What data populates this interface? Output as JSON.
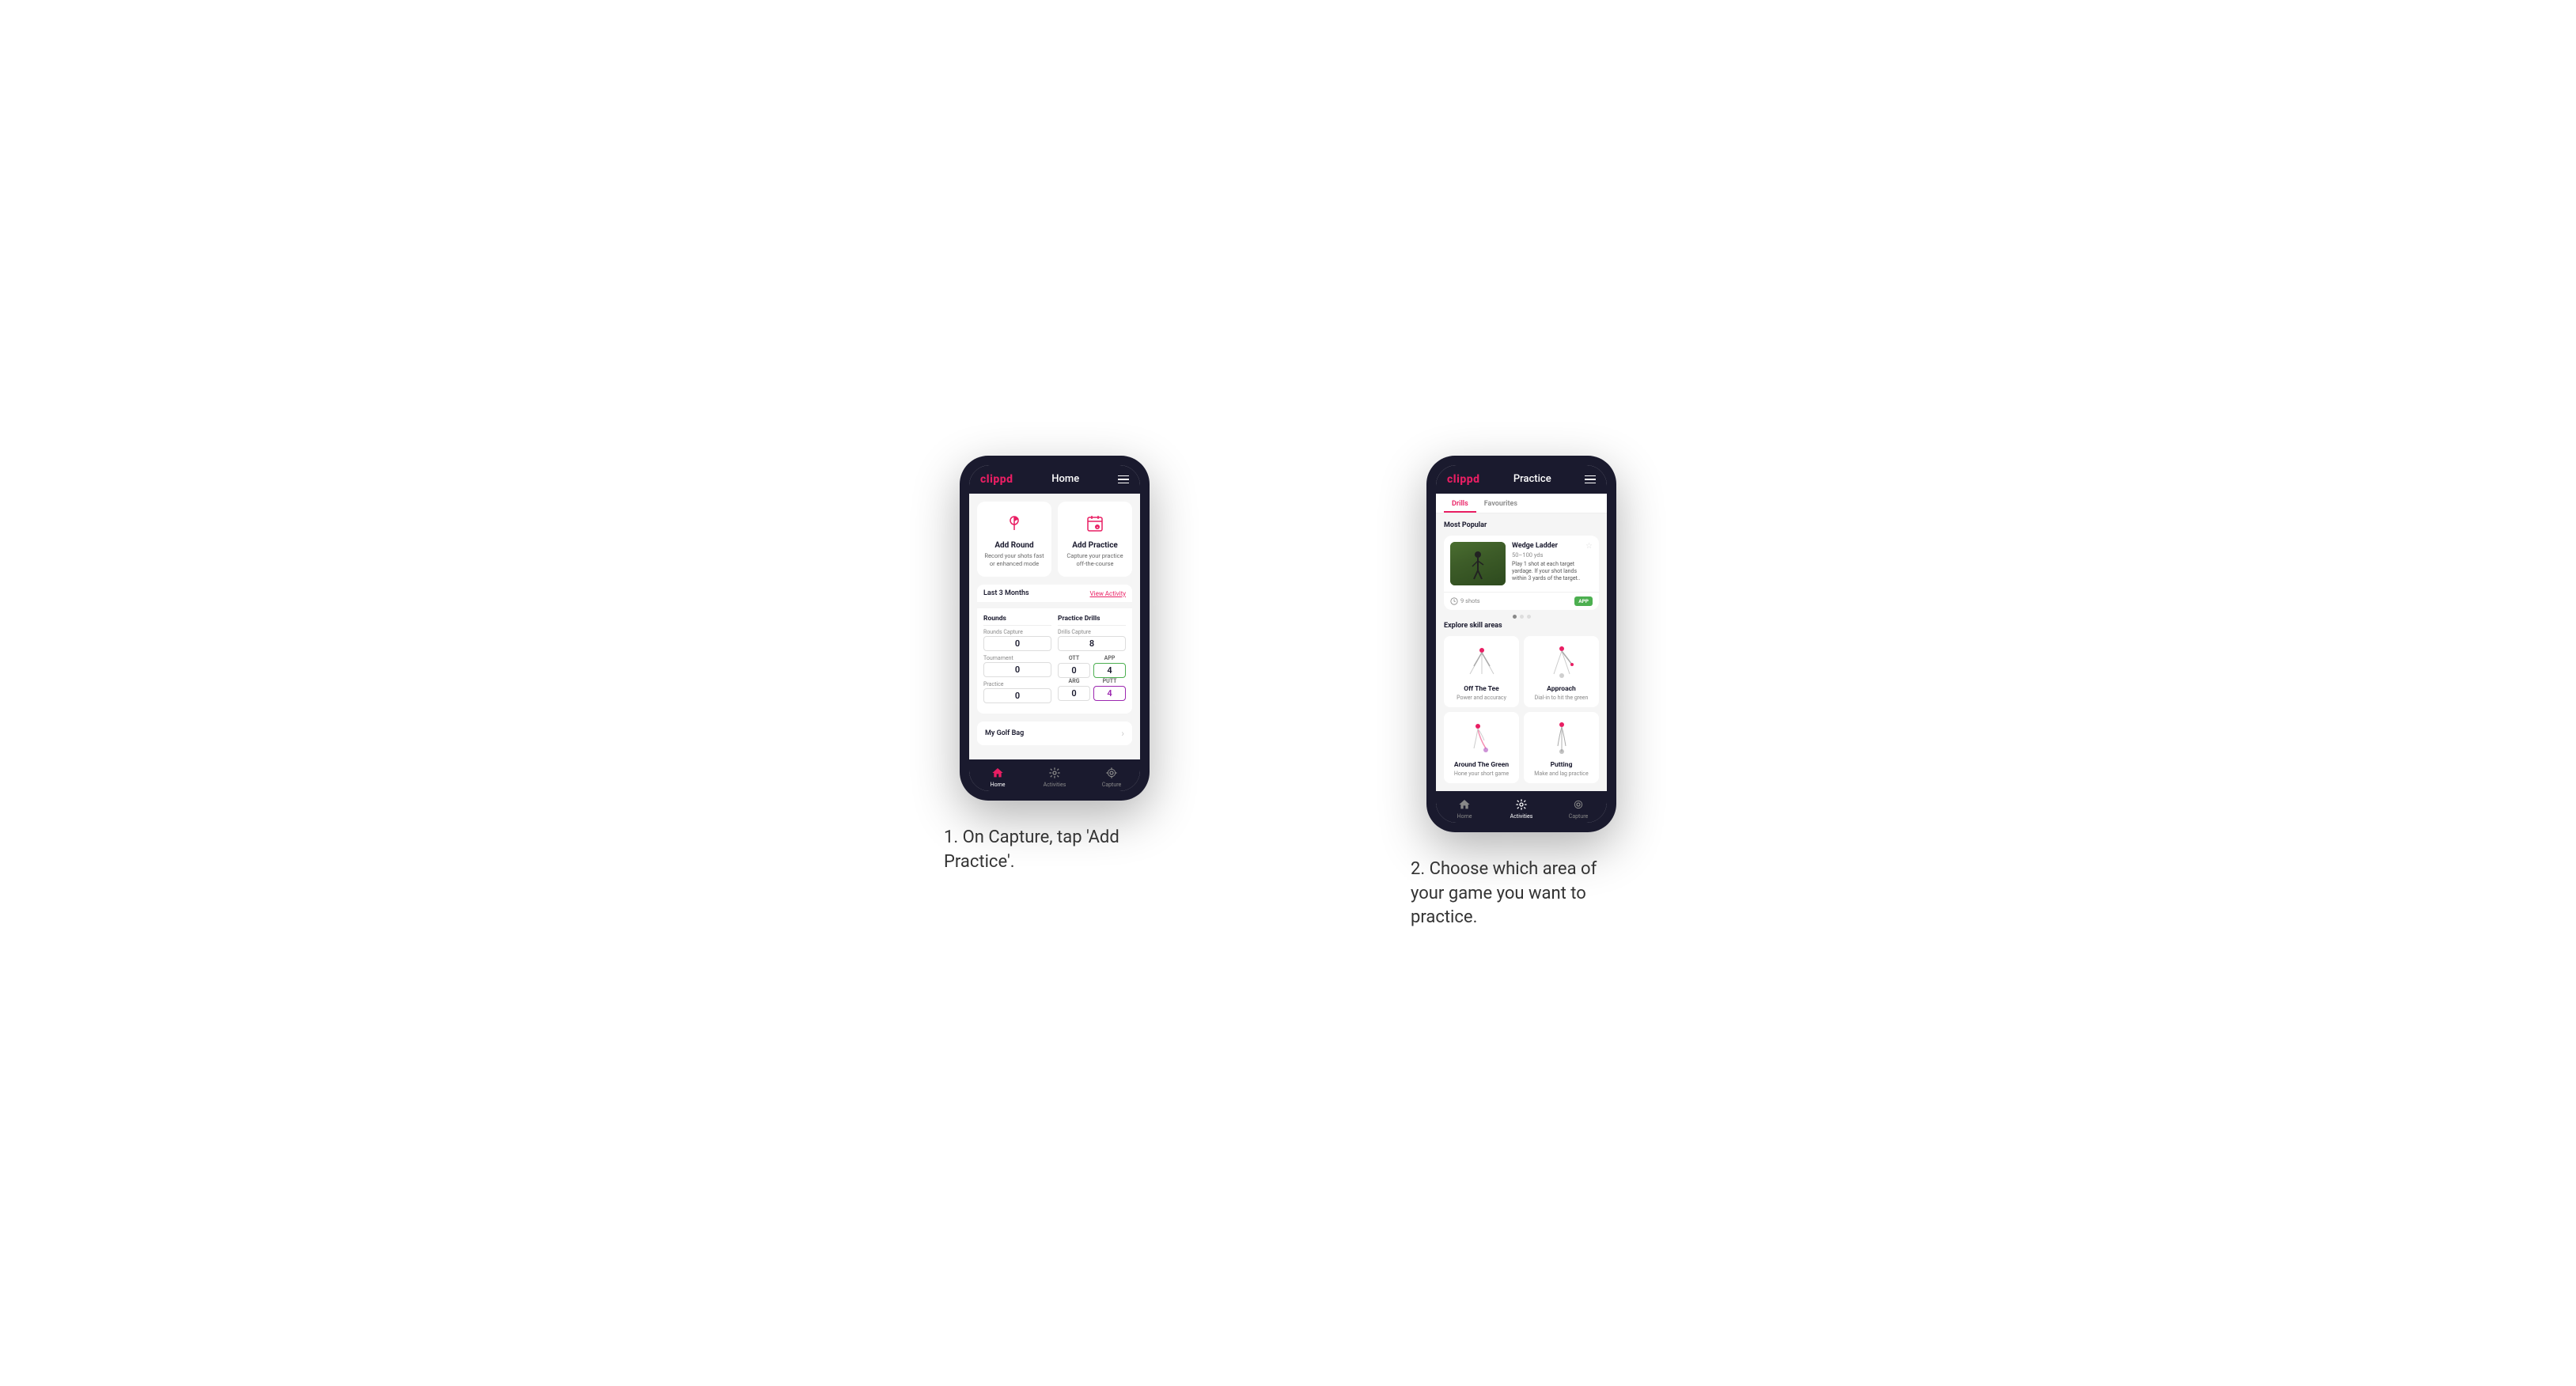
{
  "phone1": {
    "header": {
      "logo": "clippd",
      "title": "Home",
      "menu_icon": "menu"
    },
    "action_cards": [
      {
        "id": "add-round",
        "title": "Add Round",
        "description": "Record your shots fast or enhanced mode",
        "icon": "flag"
      },
      {
        "id": "add-practice",
        "title": "Add Practice",
        "description": "Capture your practice off-the-course",
        "icon": "calendar-badge"
      }
    ],
    "stats": {
      "period_label": "Last 3 Months",
      "view_activity_label": "View Activity",
      "rounds_section": {
        "title": "Rounds",
        "rounds_capture_label": "Rounds Capture",
        "rounds_capture_value": "0",
        "tournament_label": "Tournament",
        "tournament_value": "0",
        "practice_label": "Practice",
        "practice_value": "0"
      },
      "drills_section": {
        "title": "Practice Drills",
        "drills_capture_label": "Drills Capture",
        "drills_capture_value": "8",
        "ott_label": "OTT",
        "ott_value": "0",
        "app_label": "APP",
        "app_value": "4",
        "arg_label": "ARG",
        "arg_value": "0",
        "putt_label": "PUTT",
        "putt_value": "4"
      }
    },
    "golf_bag": {
      "label": "My Golf Bag"
    },
    "bottom_nav": [
      {
        "id": "home",
        "label": "Home",
        "active": true
      },
      {
        "id": "activities",
        "label": "Activities",
        "active": false
      },
      {
        "id": "capture",
        "label": "Capture",
        "active": false
      }
    ]
  },
  "phone2": {
    "header": {
      "logo": "clippd",
      "title": "Practice",
      "menu_icon": "menu"
    },
    "tabs": [
      {
        "id": "drills",
        "label": "Drills",
        "active": true
      },
      {
        "id": "favourites",
        "label": "Favourites",
        "active": false
      }
    ],
    "most_popular": {
      "section_title": "Most Popular",
      "featured_drill": {
        "title": "Wedge Ladder",
        "yards": "50–100 yds",
        "description": "Play 1 shot at each target yardage. If your shot lands within 3 yards of the target..",
        "shots": "9 shots",
        "badge": "APP"
      },
      "dots": [
        true,
        false,
        false
      ]
    },
    "skill_areas": {
      "section_title": "Explore skill areas",
      "areas": [
        {
          "id": "off-the-tee",
          "title": "Off The Tee",
          "description": "Power and accuracy"
        },
        {
          "id": "approach",
          "title": "Approach",
          "description": "Dial-in to hit the green"
        },
        {
          "id": "around-the-green",
          "title": "Around The Green",
          "description": "Hone your short game"
        },
        {
          "id": "putting",
          "title": "Putting",
          "description": "Make and lag practice"
        }
      ]
    },
    "bottom_nav": [
      {
        "id": "home",
        "label": "Home",
        "active": false
      },
      {
        "id": "activities",
        "label": "Activities",
        "active": true
      },
      {
        "id": "capture",
        "label": "Capture",
        "active": false
      }
    ]
  },
  "captions": {
    "caption1": "1. On Capture, tap 'Add Practice'.",
    "caption2": "2. Choose which area of your game you want to practice."
  },
  "colors": {
    "brand_pink": "#e91e63",
    "brand_dark": "#1a1a2e",
    "green_badge": "#4caf50",
    "purple_highlight": "#9c27b0"
  }
}
